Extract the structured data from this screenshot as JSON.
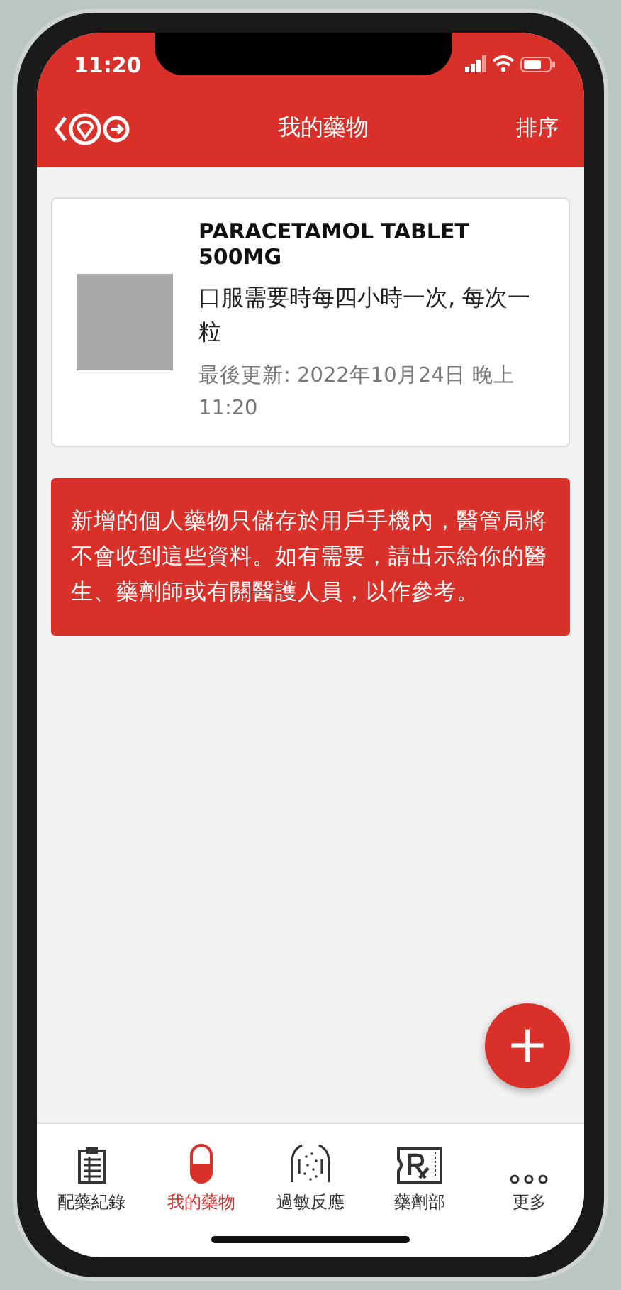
{
  "status_bar": {
    "time": "11:20"
  },
  "header": {
    "title": "我的藥物",
    "action": "排序"
  },
  "medications": [
    {
      "name": "PARACETAMOL TABLET 500MG",
      "dosage": "口服需要時每四小時一次, 每次一粒",
      "updated": "最後更新: 2022年10月24日 晚上 11:20"
    }
  ],
  "notice": "新增的個人藥物只儲存於用戶手機內，醫管局將不會收到這些資料。如有需要，請出示給你的醫生、藥劑師或有關醫護人員，以作參考。",
  "fab": "+",
  "tabs": [
    {
      "label": "配藥紀錄",
      "kind": "records",
      "selected": false
    },
    {
      "label": "我的藥物",
      "kind": "capsule",
      "selected": true
    },
    {
      "label": "過敏反應",
      "kind": "allergy",
      "selected": false
    },
    {
      "label": "藥劑部",
      "kind": "rx",
      "selected": false
    },
    {
      "label": "更多",
      "kind": "more",
      "selected": false
    }
  ]
}
